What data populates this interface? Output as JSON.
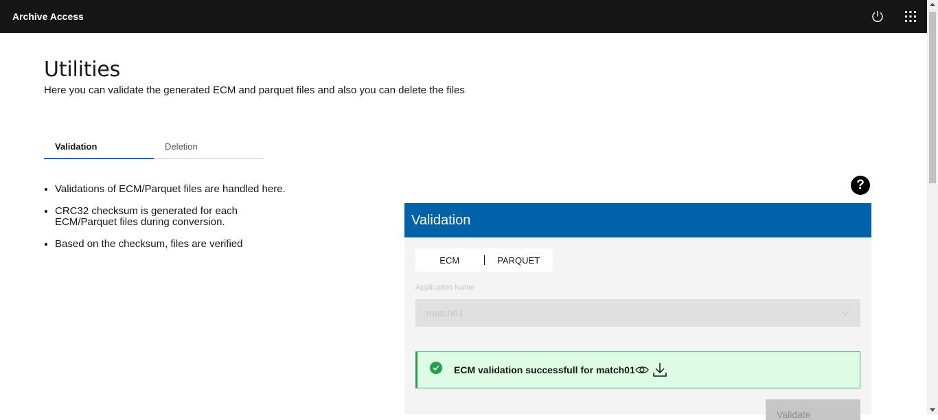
{
  "app": {
    "title": "Archive Access"
  },
  "topbar": {
    "power_icon": "power-icon",
    "apps_icon": "app-switcher-icon"
  },
  "page": {
    "title": "Utilities",
    "description": "Here you can validate the generated ECM and parquet files and also you can delete the files"
  },
  "tabs": [
    {
      "label": "Validation",
      "active": true
    },
    {
      "label": "Deletion",
      "active": false
    }
  ],
  "info_bullets": [
    "Validations of ECM/Parquet files are handled here.",
    "CRC32 checksum is generated for each ECM/Parquet files during conversion.",
    "Based on the checksum, files are verified"
  ],
  "help": {
    "icon": "help-icon",
    "glyph": "?"
  },
  "panel": {
    "title": "Validation",
    "header_color": "#0062a8",
    "file_types": [
      "ECM",
      "PARQUET"
    ],
    "application_label": "Application Name",
    "application_value": "match01",
    "notification": {
      "status": "success",
      "text": "ECM validation successfull for match01",
      "color": "#24a148"
    },
    "validate_label": "Validate"
  }
}
